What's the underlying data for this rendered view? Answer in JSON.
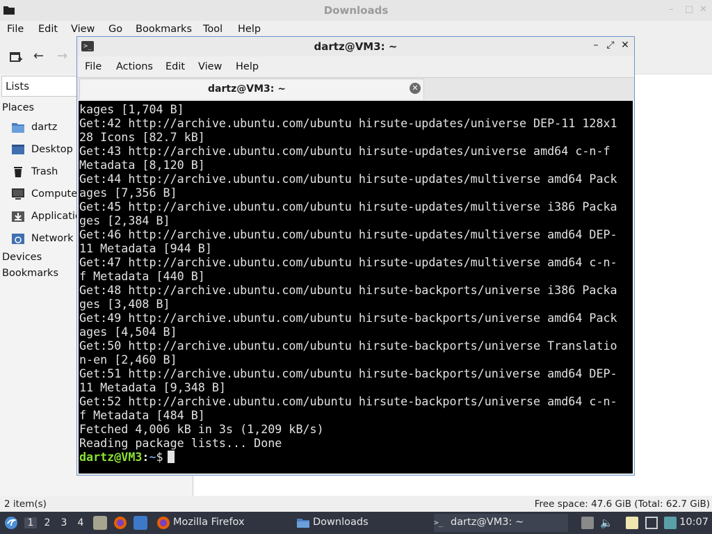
{
  "file_manager": {
    "title": "Downloads",
    "menu": [
      "File",
      "Edit",
      "View",
      "Go",
      "Bookmarks",
      "Tool",
      "Help"
    ],
    "lists_label": "Lists",
    "sections": {
      "places": "Places",
      "devices": "Devices",
      "bookmarks": "Bookmarks"
    },
    "places": [
      {
        "label": "dartz",
        "icon": "home-folder-icon"
      },
      {
        "label": "Desktop",
        "icon": "desktop-icon"
      },
      {
        "label": "Trash",
        "icon": "trash-icon"
      },
      {
        "label": "Computer",
        "icon": "computer-icon"
      },
      {
        "label": "Applications",
        "icon": "applications-icon"
      },
      {
        "label": "Network",
        "icon": "network-icon"
      }
    ],
    "status_left": "2 item(s)",
    "status_right": "Free space: 47.6 GiB (Total: 62.7 GiB)"
  },
  "terminal": {
    "title": "dartz@VM3: ~",
    "menu": [
      "File",
      "Actions",
      "Edit",
      "View",
      "Help"
    ],
    "tab_label": "dartz@VM3: ~",
    "output_lines": [
      "kages [1,704 B]",
      "Get:42 http://archive.ubuntu.com/ubuntu hirsute-updates/universe DEP-11 128x1",
      "28 Icons [82.7 kB]",
      "Get:43 http://archive.ubuntu.com/ubuntu hirsute-updates/universe amd64 c-n-f",
      "Metadata [8,120 B]",
      "Get:44 http://archive.ubuntu.com/ubuntu hirsute-updates/multiverse amd64 Pack",
      "ages [7,356 B]",
      "Get:45 http://archive.ubuntu.com/ubuntu hirsute-updates/multiverse i386 Packa",
      "ges [2,384 B]",
      "Get:46 http://archive.ubuntu.com/ubuntu hirsute-updates/multiverse amd64 DEP-",
      "11 Metadata [944 B]",
      "Get:47 http://archive.ubuntu.com/ubuntu hirsute-updates/multiverse amd64 c-n-",
      "f Metadata [440 B]",
      "Get:48 http://archive.ubuntu.com/ubuntu hirsute-backports/universe i386 Packa",
      "ges [3,408 B]",
      "Get:49 http://archive.ubuntu.com/ubuntu hirsute-backports/universe amd64 Pack",
      "ages [4,504 B]",
      "Get:50 http://archive.ubuntu.com/ubuntu hirsute-backports/universe Translatio",
      "n-en [2,460 B]",
      "Get:51 http://archive.ubuntu.com/ubuntu hirsute-backports/universe amd64 DEP-",
      "11 Metadata [9,348 B]",
      "Get:52 http://archive.ubuntu.com/ubuntu hirsute-backports/universe amd64 c-n-",
      "f Metadata [484 B]",
      "Fetched 4,006 kB in 3s (1,209 kB/s)",
      "Reading package lists... Done"
    ],
    "prompt": {
      "user_host": "dartz@VM3",
      "colon": ":",
      "path": "~",
      "symbol": "$"
    }
  },
  "taskbar": {
    "workspaces": [
      "1",
      "2",
      "3",
      "4"
    ],
    "active_workspace": "1",
    "tasks": [
      {
        "label": "Mozilla Firefox",
        "icon": "firefox-icon"
      },
      {
        "label": "Downloads",
        "icon": "folder-icon"
      },
      {
        "label": "dartz@VM3: ~",
        "icon": "terminal-icon",
        "active": true
      }
    ],
    "clock": "10:07"
  }
}
